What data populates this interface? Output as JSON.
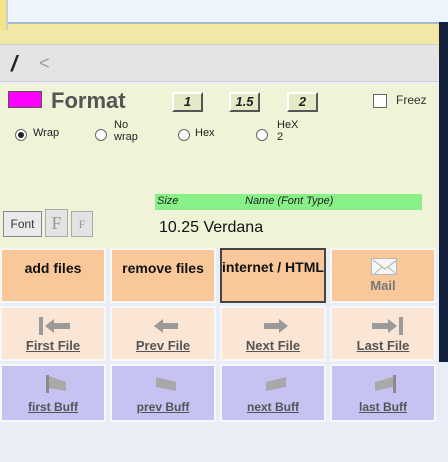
{
  "path_bar": {
    "slash": "/",
    "back_arrow": "<"
  },
  "format": {
    "color": "#ff00ff",
    "label": "Format",
    "spacing_buttons": [
      "1",
      "1.5",
      "2"
    ],
    "freeze_label": "Freez",
    "radios": [
      {
        "label": "Wrap",
        "selected": true
      },
      {
        "label_line1": "No",
        "label_line2": "wrap",
        "selected": false
      },
      {
        "label": "Hex",
        "selected": false
      },
      {
        "label_line1": "HeX",
        "label_line2": "2",
        "selected": false
      }
    ],
    "size_header": "Size",
    "name_header": "Name (Font Type)",
    "font_value": "10.25 Verdana",
    "font_button": "Font",
    "f_big": "F",
    "f_small": "F"
  },
  "buttons": {
    "add_files": "add files",
    "remove_files": "remove files",
    "internet_html": "internet / HTML",
    "mail": "Mail",
    "first_file": "First File",
    "prev_file": "Prev File",
    "next_file": "Next File",
    "last_file": "Last File",
    "first_buff": "first Buff",
    "prev_buff": "prev Buff",
    "next_buff": "next Buff",
    "last_buff": "last Buff"
  },
  "colors": {
    "accent_magenta": "#ff00ff",
    "peach": "#f8c89a",
    "light_peach": "#fbe5d4",
    "lavender": "#c6c2f1",
    "size_header_green": "#87f087"
  },
  "icons": {
    "mail": "mail-envelope-icon",
    "first": "first-icon",
    "prev": "prev-icon",
    "next": "next-icon",
    "last": "last-icon",
    "first_buff": "first-buff-icon",
    "prev_buff": "prev-buff-icon",
    "next_buff": "next-buff-icon",
    "last_buff": "last-buff-icon"
  }
}
